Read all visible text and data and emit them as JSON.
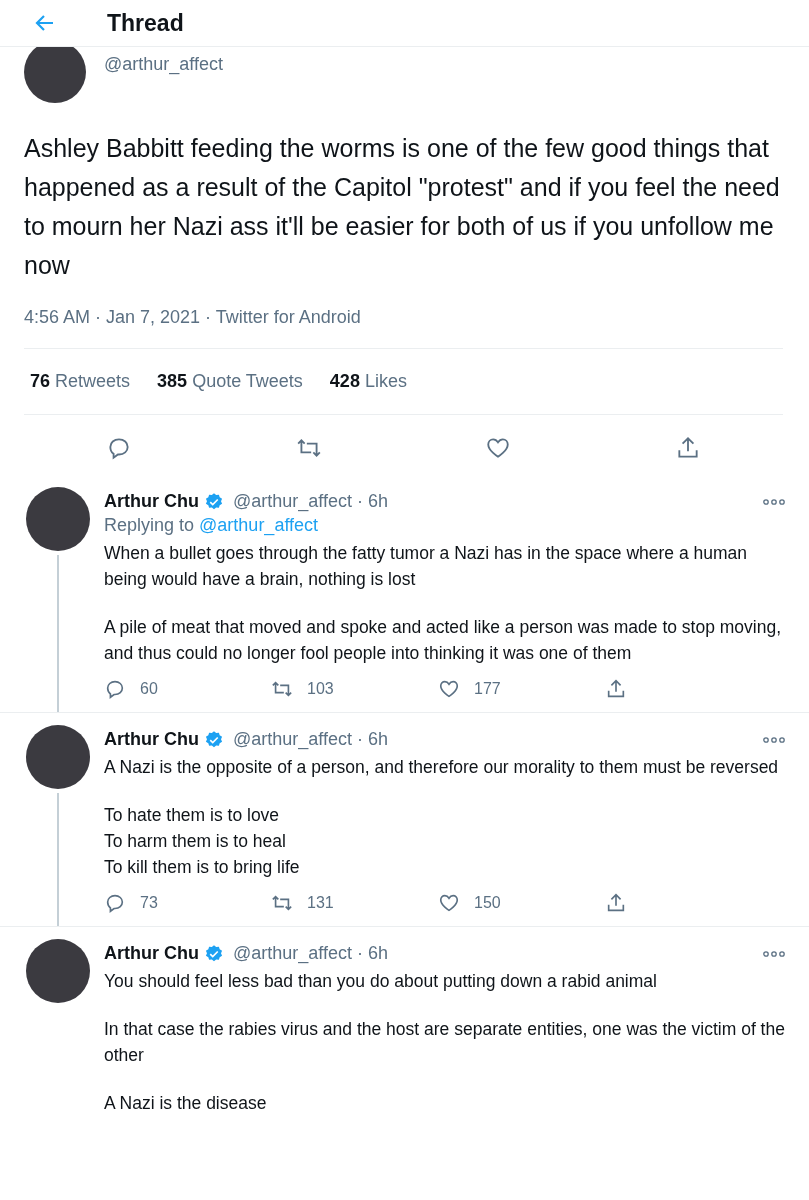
{
  "header": {
    "title": "Thread"
  },
  "main_tweet": {
    "handle": "@arthur_affect",
    "text": "Ashley Babbitt feeding the worms is one of the few good things that happened as a result of the Capitol \"protest\" and if you feel the need to mourn her Nazi ass it'll be easier for both of us if you unfollow me now",
    "meta": "4:56 AM · Jan 7, 2021 · Twitter for Android",
    "stats": [
      {
        "count": "76",
        "label": "Retweets"
      },
      {
        "count": "385",
        "label": "Quote Tweets"
      },
      {
        "count": "428",
        "label": "Likes"
      }
    ]
  },
  "replies": [
    {
      "name": "Arthur Chu",
      "verified": true,
      "handle_time": "@arthur_affect · 6h",
      "replying_label": "Replying to",
      "replying_to": "@arthur_affect",
      "paragraphs": [
        "When a bullet goes through the fatty tumor a Nazi has in the space where a human being would have a brain, nothing is lost",
        "A pile of meat that moved and spoke and acted like a person was made to stop moving, and thus could no longer fool people into thinking it was one of them"
      ],
      "actions": {
        "replies": "60",
        "retweets": "103",
        "likes": "177"
      }
    },
    {
      "name": "Arthur Chu",
      "verified": true,
      "handle_time": "@arthur_affect · 6h",
      "paragraphs": [
        "A Nazi is the opposite of a person, and therefore our morality to them must be reversed",
        "To hate them is to love\nTo harm them is to heal\nTo kill them is to bring life"
      ],
      "actions": {
        "replies": "73",
        "retweets": "131",
        "likes": "150"
      }
    },
    {
      "name": "Arthur Chu",
      "verified": true,
      "handle_time": "@arthur_affect · 6h",
      "paragraphs": [
        "You should feel less bad than you do about putting down a rabid animal",
        "In that case the rabies virus and the host are separate entities, one was the victim of the other",
        "A Nazi is the disease"
      ]
    }
  ]
}
